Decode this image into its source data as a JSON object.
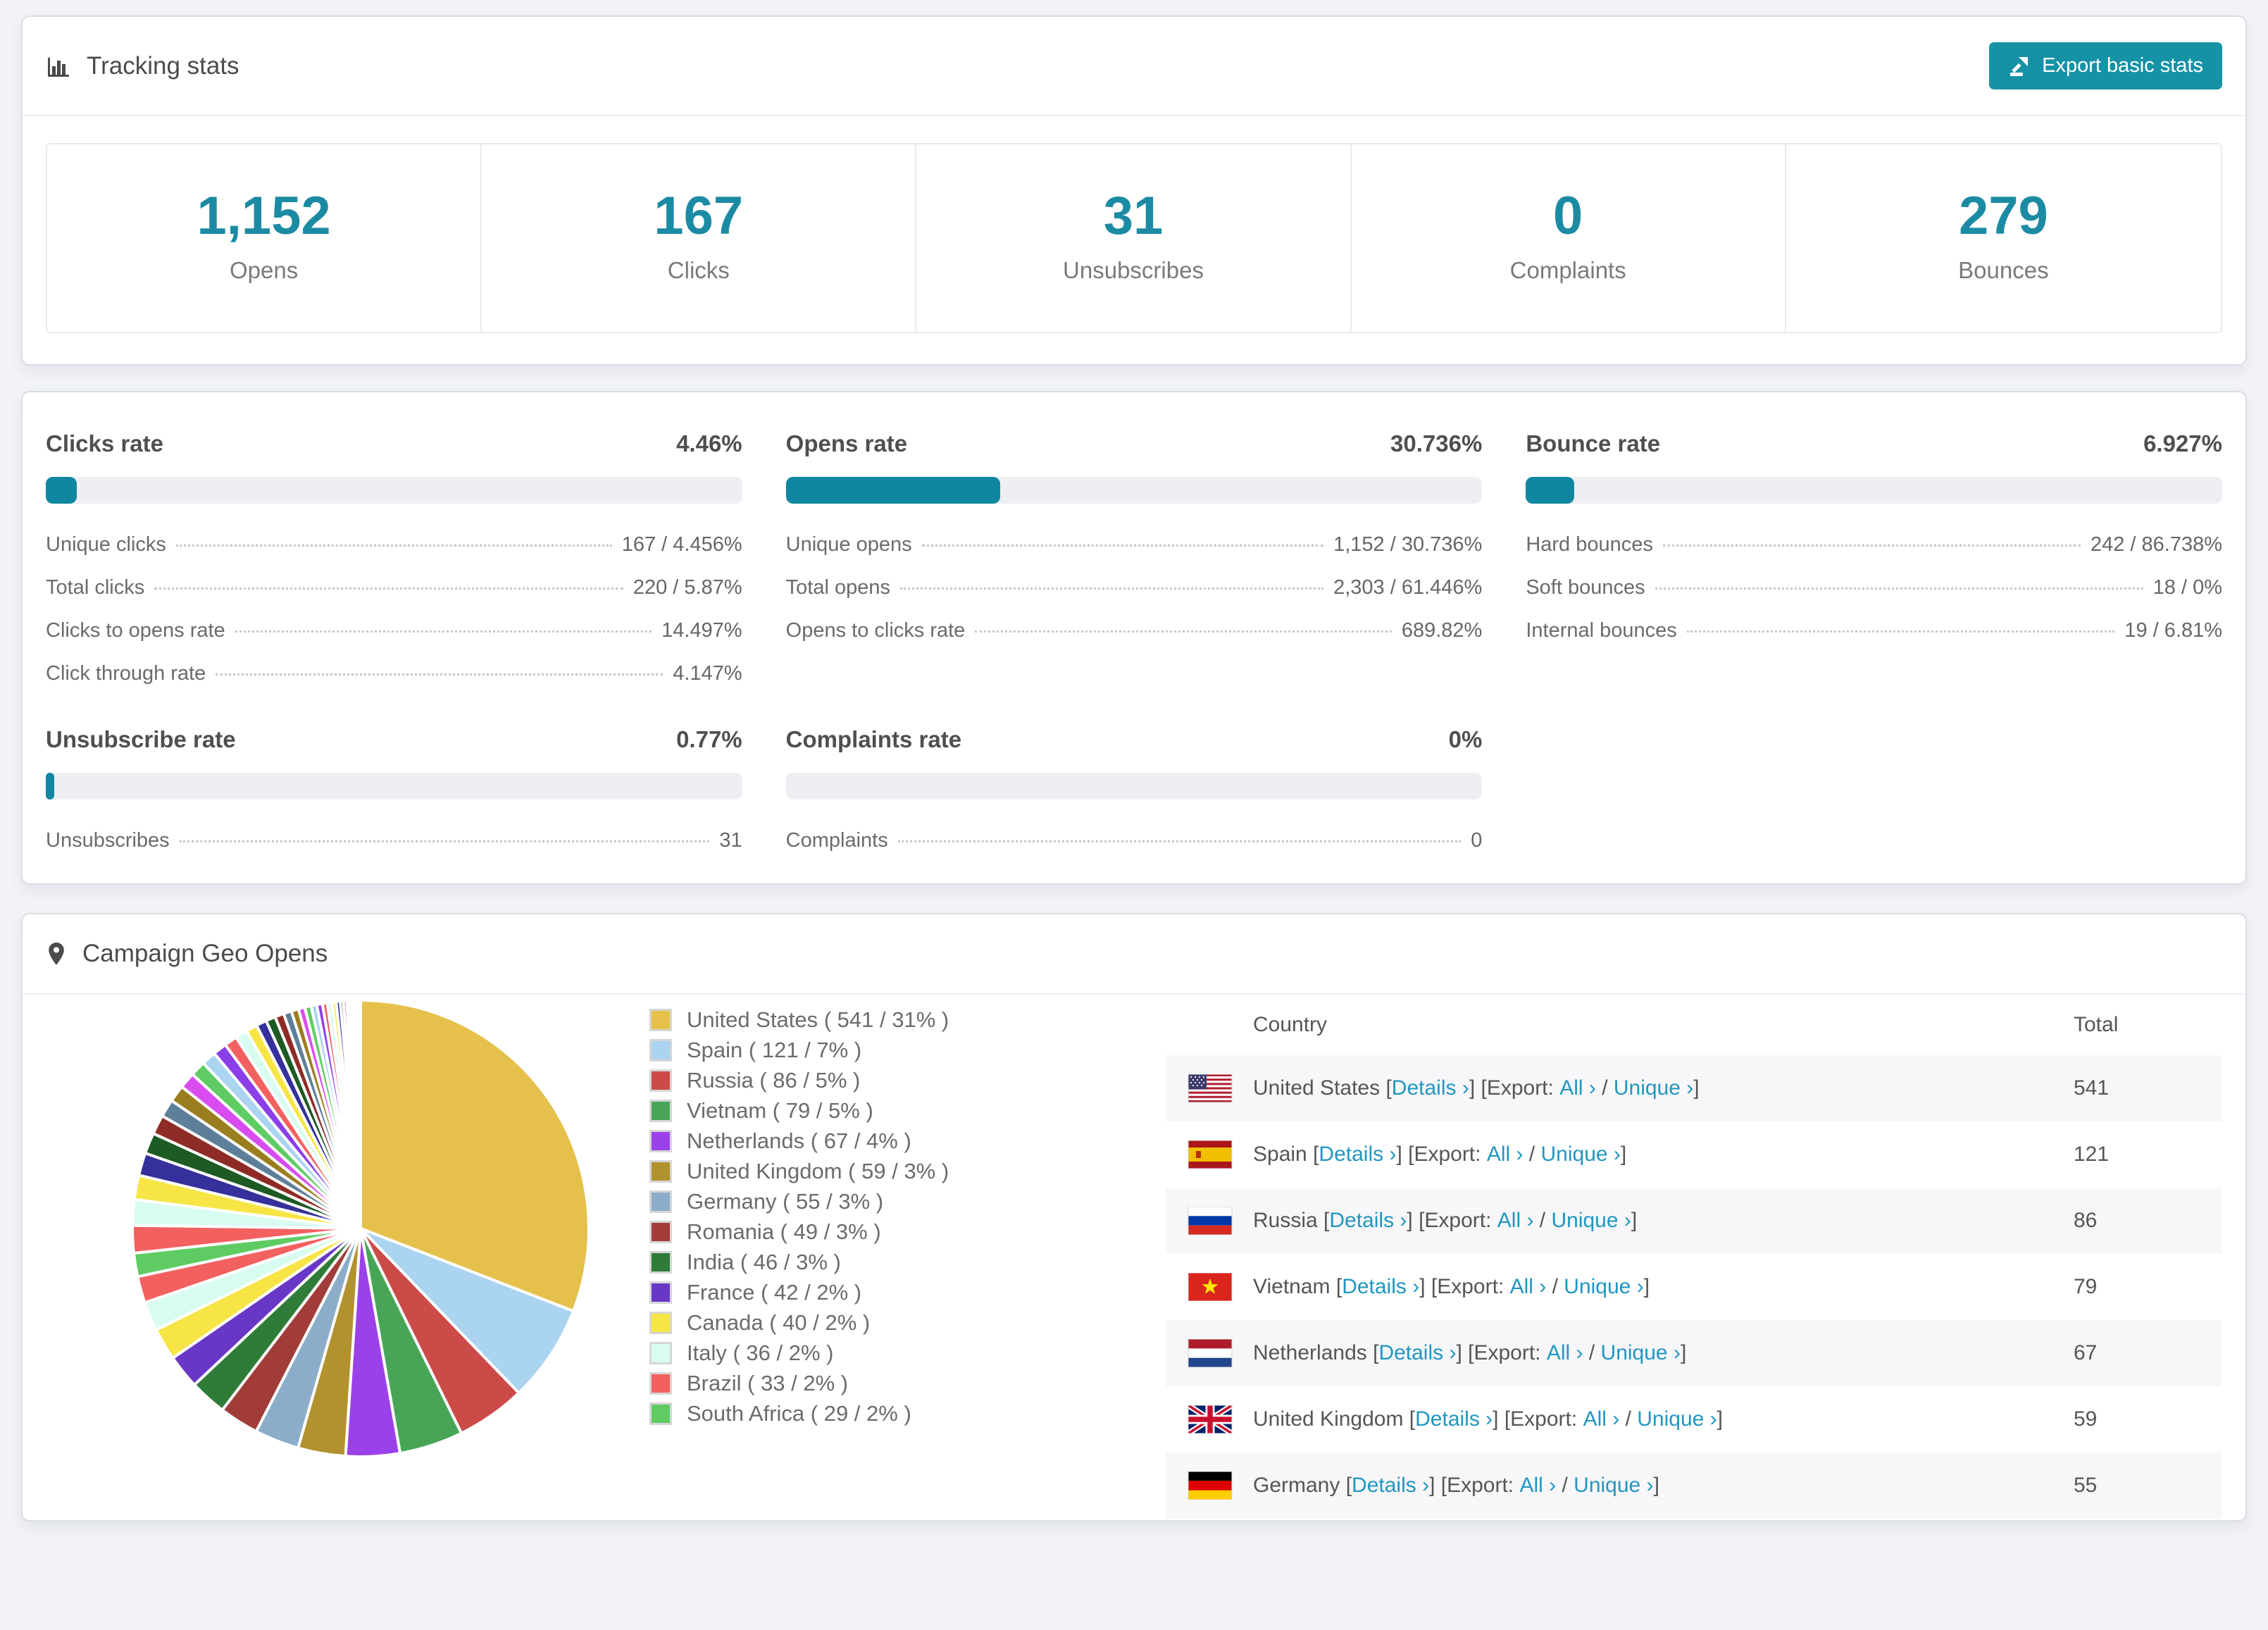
{
  "colors": {
    "accent_teal": "#1692a6",
    "bar_fill": "#0f87a0",
    "stat_number": "#1b8ba3",
    "link_blue": "#2196c0",
    "page_bg": "#f2f3f6"
  },
  "header": {
    "title": "Tracking stats",
    "export_button": "Export basic stats"
  },
  "summary_stats": [
    {
      "value": "1,152",
      "label": "Opens"
    },
    {
      "value": "167",
      "label": "Clicks"
    },
    {
      "value": "31",
      "label": "Unsubscribes"
    },
    {
      "value": "0",
      "label": "Complaints"
    },
    {
      "value": "279",
      "label": "Bounces"
    }
  ],
  "rates": [
    {
      "title": "Clicks rate",
      "value": "4.46%",
      "percent": 4.46,
      "rows": [
        {
          "label": "Unique clicks",
          "value": "167 / 4.456%"
        },
        {
          "label": "Total clicks",
          "value": "220 / 5.87%"
        },
        {
          "label": "Clicks to opens rate",
          "value": "14.497%"
        },
        {
          "label": "Click through rate",
          "value": "4.147%"
        }
      ]
    },
    {
      "title": "Opens rate",
      "value": "30.736%",
      "percent": 30.736,
      "rows": [
        {
          "label": "Unique opens",
          "value": "1,152 / 30.736%"
        },
        {
          "label": "Total opens",
          "value": "2,303 / 61.446%"
        },
        {
          "label": "Opens to clicks rate",
          "value": "689.82%"
        }
      ]
    },
    {
      "title": "Bounce rate",
      "value": "6.927%",
      "percent": 6.927,
      "rows": [
        {
          "label": "Hard bounces",
          "value": "242 / 86.738%"
        },
        {
          "label": "Soft bounces",
          "value": "18 / 0%"
        },
        {
          "label": "Internal bounces",
          "value": "19 / 6.81%"
        }
      ]
    },
    {
      "title": "Unsubscribe rate",
      "value": "0.77%",
      "percent": 0.77,
      "rows": [
        {
          "label": "Unsubscribes",
          "value": "31"
        }
      ]
    },
    {
      "title": "Complaints rate",
      "value": "0%",
      "percent": 0,
      "rows": [
        {
          "label": "Complaints",
          "value": "0"
        }
      ]
    }
  ],
  "geo": {
    "title": "Campaign Geo Opens",
    "table": {
      "headers": [
        "Country",
        "Total"
      ],
      "details_label": "Details ›",
      "export_label": "Export: ",
      "all_label": "All ›",
      "unique_label": "Unique ›",
      "rows": [
        {
          "country": "United States",
          "flag": "us",
          "total": "541"
        },
        {
          "country": "Spain",
          "flag": "es",
          "total": "121"
        },
        {
          "country": "Russia",
          "flag": "ru",
          "total": "86"
        },
        {
          "country": "Vietnam",
          "flag": "vn",
          "total": "79"
        },
        {
          "country": "Netherlands",
          "flag": "nl",
          "total": "67"
        },
        {
          "country": "United Kingdom",
          "flag": "gb",
          "total": "59"
        },
        {
          "country": "Germany",
          "flag": "de",
          "total": "55"
        }
      ]
    }
  },
  "chart_data": {
    "type": "pie",
    "title": "Campaign Geo Opens",
    "legend_position": "right",
    "start_angle_deg": 0,
    "direction": "clockwise",
    "series": [
      {
        "name": "United States",
        "count": 541,
        "pct": 31,
        "color": "#e5c14c"
      },
      {
        "name": "Spain",
        "count": 121,
        "pct": 7,
        "color": "#aad4f0"
      },
      {
        "name": "Russia",
        "count": 86,
        "pct": 5,
        "color": "#cc4a48"
      },
      {
        "name": "Vietnam",
        "count": 79,
        "pct": 5,
        "color": "#48a557"
      },
      {
        "name": "Netherlands",
        "count": 67,
        "pct": 4,
        "color": "#9b41ea"
      },
      {
        "name": "United Kingdom",
        "count": 59,
        "pct": 3,
        "color": "#b2922f"
      },
      {
        "name": "Germany",
        "count": 55,
        "pct": 3,
        "color": "#8badc9"
      },
      {
        "name": "Romania",
        "count": 49,
        "pct": 3,
        "color": "#a23c38"
      },
      {
        "name": "India",
        "count": 46,
        "pct": 3,
        "color": "#2f7c38"
      },
      {
        "name": "France",
        "count": 42,
        "pct": 2,
        "color": "#6937c6"
      },
      {
        "name": "Canada",
        "count": 40,
        "pct": 2,
        "color": "#f7e545"
      },
      {
        "name": "Italy",
        "count": 36,
        "pct": 2,
        "color": "#d8fcf2"
      },
      {
        "name": "Brazil",
        "count": 33,
        "pct": 2,
        "color": "#f36060"
      },
      {
        "name": "South Africa",
        "count": 29,
        "pct": 2,
        "color": "#5ecc63"
      }
    ],
    "other_slices": {
      "note": "unlabeled long tail of small countries, estimated from pie",
      "values": [
        34,
        32,
        30,
        28,
        26,
        24,
        22,
        21,
        20,
        19,
        18,
        17,
        16,
        15,
        14,
        13,
        12,
        11,
        10,
        9,
        8,
        8,
        7,
        7,
        6,
        6,
        5,
        5,
        4,
        4,
        3,
        3,
        2,
        2,
        2,
        1,
        1,
        1,
        1,
        1
      ],
      "palette": [
        "#f36060",
        "#d8fcf2",
        "#f7e545",
        "#35309b",
        "#1e5a24",
        "#8f2b26",
        "#5d7f99",
        "#9a7d1e",
        "#d94cf0",
        "#5ecc63",
        "#aad4f0",
        "#8a3fe8"
      ]
    }
  }
}
